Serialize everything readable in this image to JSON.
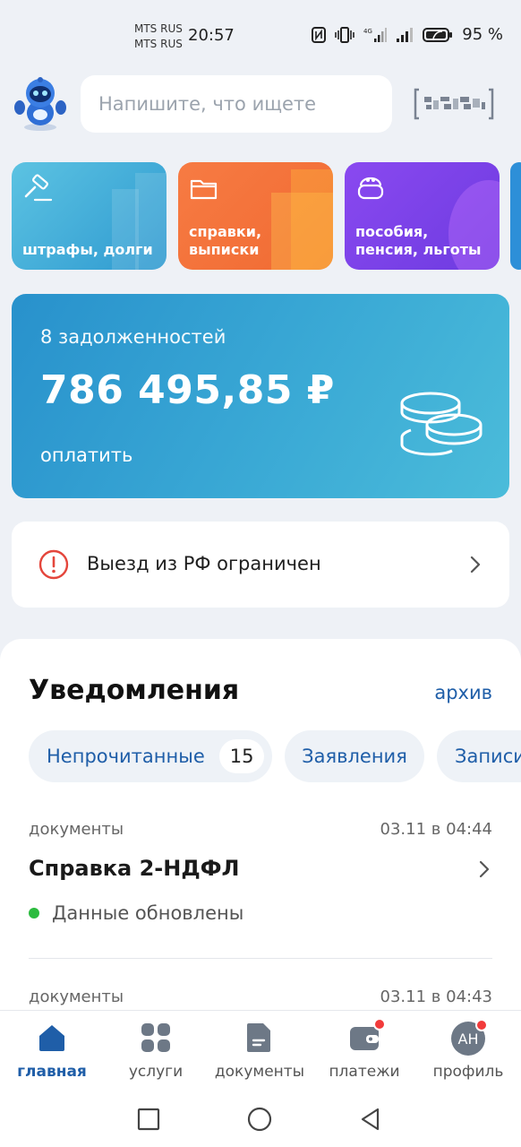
{
  "status_bar": {
    "carrier_1": "MTS RUS",
    "carrier_2": "MTS RUS",
    "time": "20:57",
    "battery": "95 %"
  },
  "header": {
    "search_placeholder": "Напишите, что ищете"
  },
  "categories": [
    {
      "label": "штрафы, долги",
      "icon": "gavel-icon"
    },
    {
      "label": "справки,\nвыписки",
      "icon": "folder-icon"
    },
    {
      "label": "пособия,\nпенсия, льготы",
      "icon": "wallet-purse-icon"
    }
  ],
  "debt": {
    "count_text": "8 задолженностей",
    "amount": "786 495,85 ₽",
    "pay_label": "оплатить"
  },
  "restriction": {
    "text": "Выезд из РФ ограничен"
  },
  "notifications": {
    "title": "Уведомления",
    "archive_label": "архив",
    "chips": {
      "unread_label": "Непрочитанные",
      "unread_count": "15",
      "applications_label": "Заявления",
      "records_label": "Записи"
    },
    "items": [
      {
        "category": "документы",
        "time": "03.11 в 04:44",
        "title": "Справка 2-НДФЛ",
        "status": "Данные обновлены"
      },
      {
        "category": "документы",
        "time": "03.11 в 04:43"
      }
    ]
  },
  "bottom_nav": [
    {
      "label": "главная",
      "icon": "home-icon",
      "active": true
    },
    {
      "label": "услуги",
      "icon": "grid-icon"
    },
    {
      "label": "документы",
      "icon": "document-icon"
    },
    {
      "label": "платежи",
      "icon": "wallet-icon",
      "badge": true
    },
    {
      "label": "профиль",
      "icon": "avatar",
      "initials": "АН",
      "badge": true
    }
  ],
  "colors": {
    "accent": "#1f5ea8",
    "background": "#eef1f6",
    "status_green": "#2cbb3f",
    "badge_red": "#f23b3b",
    "alert_red": "#e4463c"
  }
}
